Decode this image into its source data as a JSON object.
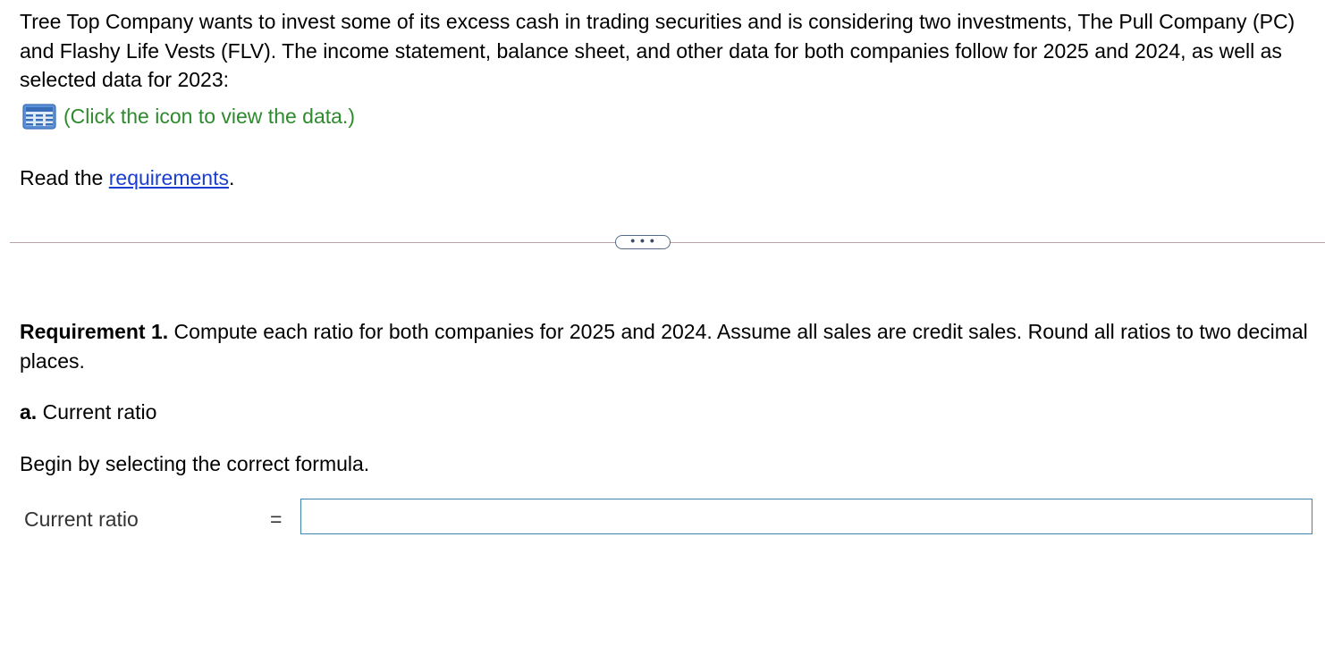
{
  "intro": {
    "text": "Tree Top Company wants to invest some of its excess cash in trading securities and is considering two investments, The Pull Company (PC) and Flashy Life Vests (FLV). The income statement, balance sheet, and other data for both companies follow for 2025 and 2024, as well as selected data for 2023:"
  },
  "data_link": {
    "icon": "table-icon",
    "label": "(Click the icon to view the data.)",
    "color": "#2e8a2e"
  },
  "requirements_line": {
    "prefix": "Read the ",
    "link_label": "requirements",
    "suffix": ".",
    "link_color": "#1a3ecf"
  },
  "divider": {
    "button_label": "• • •"
  },
  "requirement1": {
    "heading": "Requirement 1.",
    "text": " Compute each ratio for both companies for 2025 and 2024. Assume all sales are credit sales. Round all ratios to two decimal places."
  },
  "part_a": {
    "letter": "a.",
    "text": " Current ratio"
  },
  "instruction": {
    "text": "Begin by selecting the correct formula."
  },
  "formula": {
    "label": "Current ratio",
    "equals": "=",
    "input_value": "",
    "input_border_color": "#3f87a8"
  }
}
